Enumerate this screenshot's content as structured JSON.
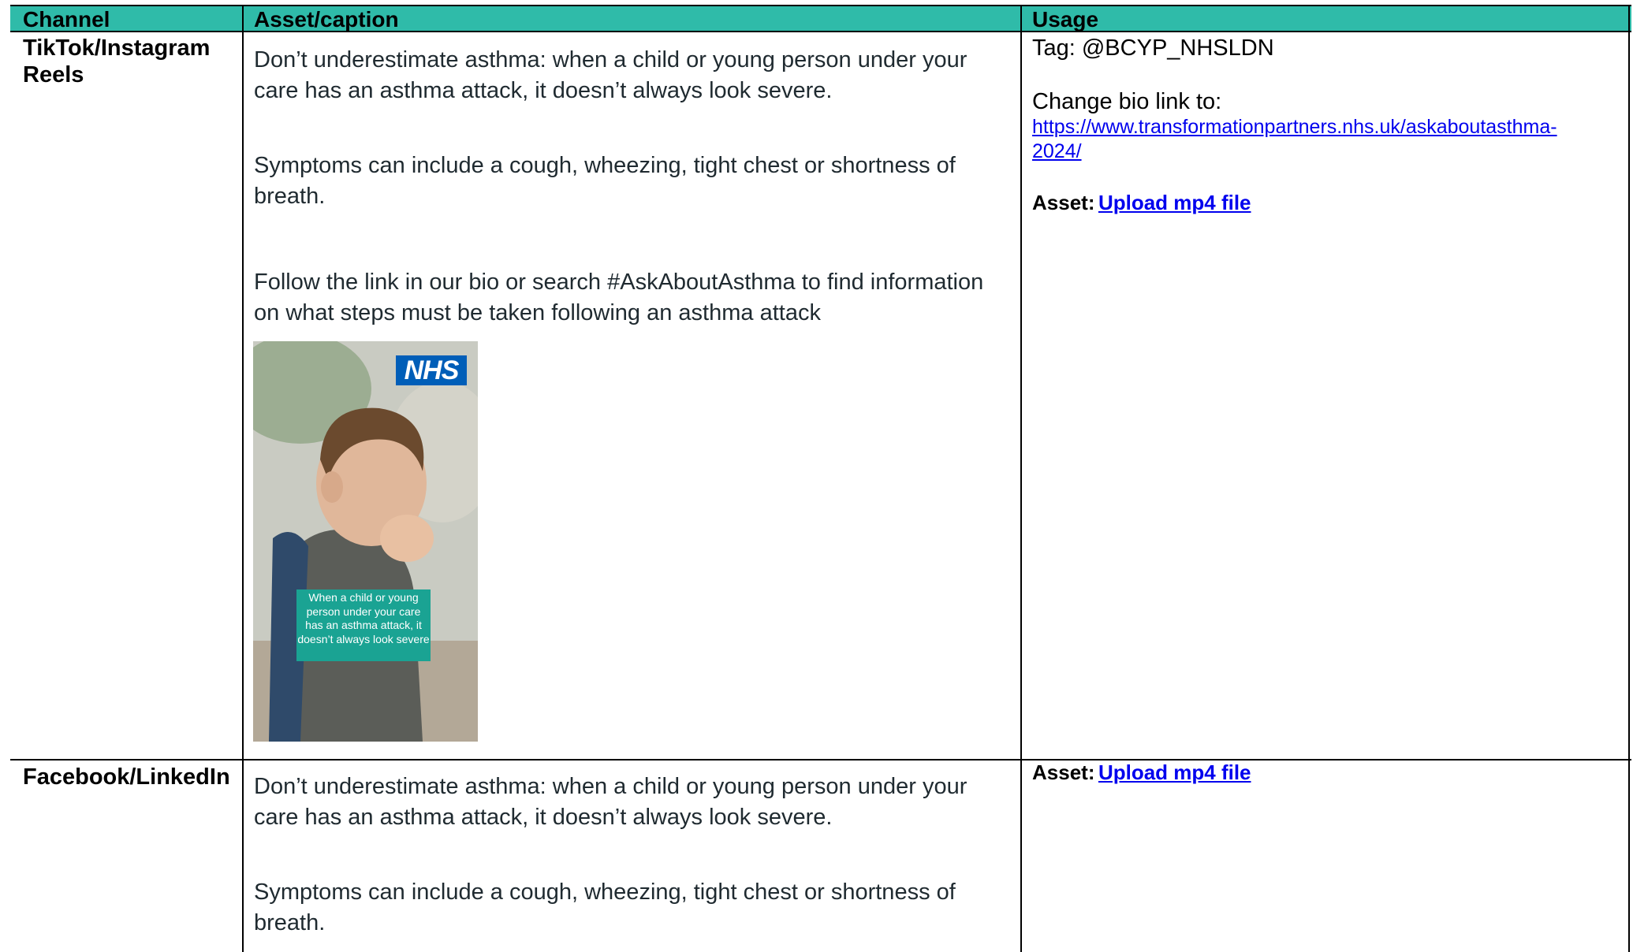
{
  "headers": {
    "channel": "Channel",
    "asset": "Asset/caption",
    "usage": "Usage"
  },
  "rows": [
    {
      "channel": "TikTok/Instagram Reels",
      "captions": [
        "Don’t underestimate asthma: when a child or young person under your care has an asthma attack, it doesn’t always look severe.",
        "Symptoms can include a cough, wheezing, tight chest or shortness of breath.",
        "Follow the link in our bio or search #AskAboutAsthma to find information on what steps must be taken following an asthma attack"
      ],
      "image": {
        "logo_text": "NHS",
        "overlay_text": "When a child or young person under your care has an asthma attack, it doesn’t always look severe"
      },
      "usage": {
        "tag": "Tag: @BCYP_NHSLDN",
        "bio_label": "Change bio link to:",
        "bio_link": "https://www.transformationpartners.nhs.uk/askaboutasthma-2024/",
        "asset_label": "Asset:",
        "asset_link": "Upload mp4 file"
      }
    },
    {
      "channel": "Facebook/LinkedIn",
      "captions": [
        "Don’t underestimate asthma: when a child or young person under your care has an asthma attack, it doesn’t always look severe.",
        "Symptoms can include a cough, wheezing, tight chest or shortness of breath."
      ],
      "usage": {
        "asset_label": "Asset:",
        "asset_link": "Upload mp4 file"
      }
    }
  ],
  "colors": {
    "header_bg": "#2fbba9",
    "link": "#0000ee",
    "nhs_blue": "#005eb8",
    "overlay_teal": "#1aa393"
  }
}
